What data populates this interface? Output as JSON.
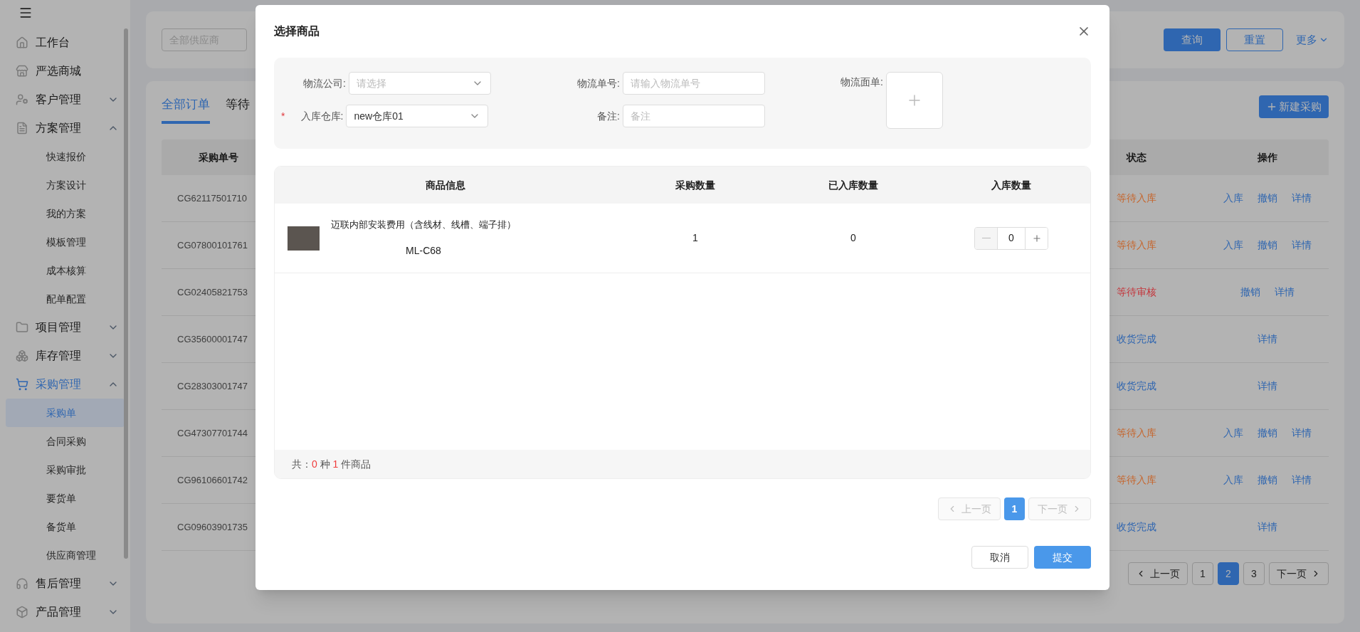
{
  "sidebar": {
    "items": [
      {
        "label": "工作台",
        "selected": false
      },
      {
        "label": "严选商城",
        "selected": false
      },
      {
        "label": "客户管理",
        "selected": false,
        "expanded": false
      },
      {
        "label": "方案管理",
        "selected": false,
        "expanded": true,
        "children": [
          {
            "label": "快速报价",
            "selected": false
          },
          {
            "label": "方案设计",
            "selected": false
          },
          {
            "label": "我的方案",
            "selected": false
          },
          {
            "label": "模板管理",
            "selected": false
          },
          {
            "label": "成本核算",
            "selected": false
          },
          {
            "label": "配单配置",
            "selected": false
          }
        ]
      },
      {
        "label": "项目管理",
        "selected": false,
        "expanded": false
      },
      {
        "label": "库存管理",
        "selected": false,
        "expanded": false
      },
      {
        "label": "采购管理",
        "selected": true,
        "expanded": true,
        "children": [
          {
            "label": "采购单",
            "selected": true
          },
          {
            "label": "合同采购",
            "selected": false
          },
          {
            "label": "采购审批",
            "selected": false
          },
          {
            "label": "要货单",
            "selected": false
          },
          {
            "label": "备货单",
            "selected": false
          },
          {
            "label": "供应商管理",
            "selected": false
          }
        ]
      },
      {
        "label": "售后管理",
        "selected": false,
        "expanded": false
      },
      {
        "label": "产品管理",
        "selected": false,
        "expanded": false
      }
    ]
  },
  "filter": {
    "supplier_placeholder": "全部供应商",
    "query_button": "查询",
    "reset_button": "重置",
    "more_link": "更多"
  },
  "orders": {
    "tabs": [
      {
        "label": "全部订单",
        "selected": true
      },
      {
        "label": "等待",
        "selected": false
      }
    ],
    "new_button": "新建采购",
    "columns": [
      "采购单号",
      "状态",
      "操作"
    ],
    "rows": [
      {
        "order_no": "CG62117501710",
        "status": "等待入库",
        "color": "#c6642a",
        "actions": [
          "入库",
          "撤销",
          "详情"
        ]
      },
      {
        "order_no": "CG07800101761",
        "status": "等待入库",
        "color": "#c6642a",
        "actions": [
          "入库",
          "撤销",
          "详情"
        ]
      },
      {
        "order_no": "CG02405821753",
        "status": "等待审核",
        "color": "#c4343a",
        "actions": [
          "撤销",
          "详情"
        ]
      },
      {
        "order_no": "CG35600001747",
        "status": "收货完成",
        "color": "#3066b0",
        "actions": [
          "详情"
        ]
      },
      {
        "order_no": "CG28303001747",
        "status": "收货完成",
        "color": "#3066b0",
        "actions": [
          "详情"
        ]
      },
      {
        "order_no": "CG47307701744",
        "status": "等待入库",
        "color": "#c6642a",
        "actions": [
          "入库",
          "撤销",
          "详情"
        ]
      },
      {
        "order_no": "CG96106601742",
        "status": "等待入库",
        "color": "#c6642a",
        "actions": [
          "入库",
          "撤销",
          "详情"
        ]
      },
      {
        "order_no": "CG09603901735",
        "status": "收货完成",
        "color": "#3066b0",
        "actions": [
          "详情"
        ]
      }
    ],
    "pagination": {
      "prev": "上一页",
      "next": "下一页",
      "pages": [
        {
          "label": "1",
          "selected": false
        },
        {
          "label": "2",
          "selected": true
        },
        {
          "label": "3",
          "selected": false
        }
      ]
    }
  },
  "dialog": {
    "title": "选择商品",
    "form": {
      "carrier": {
        "label": "物流公司:",
        "placeholder": "请选择"
      },
      "tracking_no": {
        "label": "物流单号:",
        "placeholder": "请输入物流单号"
      },
      "waybill": {
        "label": "物流面单:"
      },
      "warehouse": {
        "required_mark": "*",
        "label": "入库仓库:",
        "value": "new仓库01"
      },
      "remark": {
        "label": "备注:",
        "placeholder": "备注"
      }
    },
    "columns": [
      "商品信息",
      "采购数量",
      "已入库数量",
      "入库数量"
    ],
    "items": [
      {
        "name": "迈联内部安装费用（含线材、线槽、端子排）",
        "code": "ML-C68",
        "purchase_qty": "1",
        "received_qty": "0",
        "inbound_qty": "0"
      }
    ],
    "summary": {
      "prefix": "共：",
      "kinds": "0",
      "kinds_unit": "种",
      "pieces": "1",
      "pieces_unit": "件商品"
    },
    "pagination": {
      "prev": "上一页",
      "next": "下一页",
      "prev_disabled": true,
      "next_disabled": true,
      "pages": [
        {
          "label": "1",
          "selected": true
        }
      ]
    },
    "cancel_button": "取消",
    "submit_button": "提交"
  }
}
